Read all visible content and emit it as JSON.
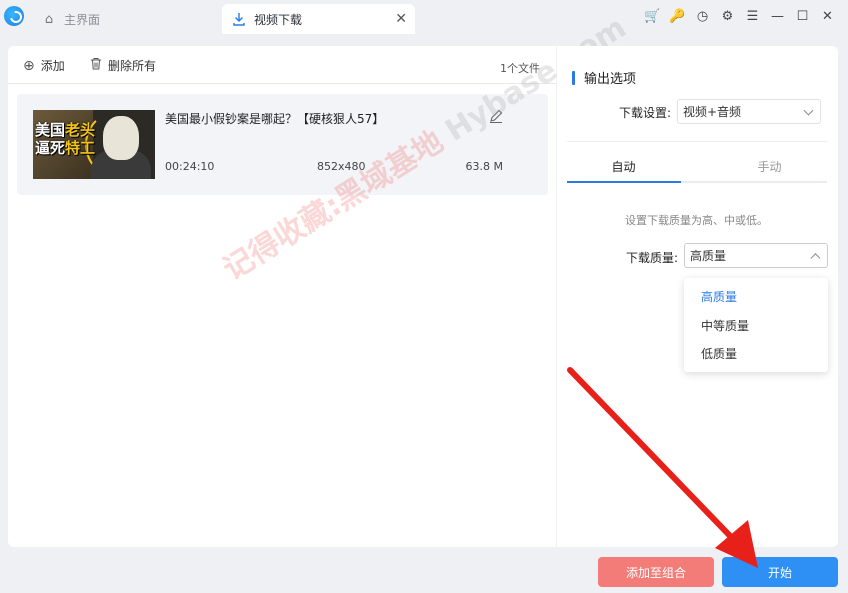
{
  "titlebar": {
    "tabs": [
      {
        "label": "主界面"
      },
      {
        "label": "视频下载",
        "close": "✕"
      }
    ],
    "controls": {
      "cart": "🛒",
      "key": "🔑",
      "history": "◷",
      "settings": "⚙",
      "menu": "☰",
      "minimize": "—",
      "maximize": "☐",
      "close": "✕"
    }
  },
  "toolbar": {
    "add_label": "添加",
    "delete_all_label": "删除所有",
    "file_count": "1个文件"
  },
  "file": {
    "thumb_line1": "美国",
    "thumb_line1b": "老头",
    "thumb_line2": "逼死",
    "thumb_line2b": "特工",
    "title": "美国最小假钞案是哪起？【硬核狠人57】",
    "duration": "00:24:10",
    "resolution": "852x480",
    "size": "63.8 M"
  },
  "output": {
    "section_title": "输出选项",
    "download_setting_label": "下载设置:",
    "download_setting_value": "视频+音频",
    "tabs": {
      "auto": "自动",
      "manual": "手动"
    },
    "quality_hint": "设置下载质量为高、中或低。",
    "quality_label": "下载质量:",
    "quality_value": "高质量",
    "quality_options": [
      "高质量",
      "中等质量",
      "低质量"
    ]
  },
  "actions": {
    "combine_label": "添加至组合",
    "start_label": "开始"
  },
  "watermark": {
    "cn": "记得收藏:黑域基地",
    "en": "Hybase.com"
  },
  "colors": {
    "accent": "#2a7be4",
    "start_button": "#2e8ff5",
    "combine_button": "#f47c78",
    "arrow": "#e8201a"
  }
}
